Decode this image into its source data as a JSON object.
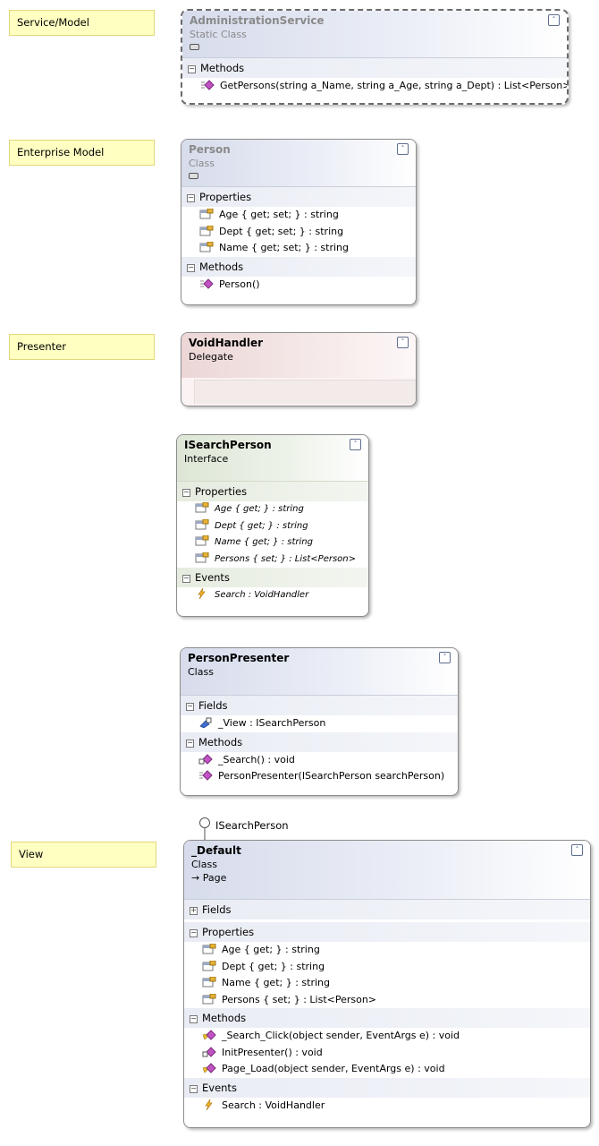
{
  "notes": {
    "service": "Service/Model",
    "enterprise": "Enterprise Model",
    "presenter": "Presenter",
    "view": "View"
  },
  "admin": {
    "name": "AdministrationService",
    "kind": "Static Class",
    "sections": [
      {
        "label": "Methods",
        "items": [
          "GetPersons(string a_Name, string a_Age, string a_Dept) : List<Person>"
        ]
      }
    ]
  },
  "person": {
    "name": "Person",
    "kind": "Class",
    "sections": [
      {
        "label": "Properties",
        "items": [
          "Age { get; set; } : string",
          "Dept { get; set; } : string",
          "Name { get; set; } : string"
        ]
      },
      {
        "label": "Methods",
        "items": [
          "Person()"
        ]
      }
    ]
  },
  "voidhandler": {
    "name": "VoidHandler",
    "kind": "Delegate"
  },
  "isearch": {
    "name": "ISearchPerson",
    "kind": "Interface",
    "sections": [
      {
        "label": "Properties",
        "items": [
          "Age { get; } : string",
          "Dept { get; } : string",
          "Name { get; } : string",
          "Persons { set; } : List<Person>"
        ]
      },
      {
        "label": "Events",
        "items": [
          "Search : VoidHandler"
        ]
      }
    ]
  },
  "presenter": {
    "name": "PersonPresenter",
    "kind": "Class",
    "sections": [
      {
        "label": "Fields",
        "items": [
          "_View : ISearchPerson"
        ]
      },
      {
        "label": "Methods",
        "items": [
          "_Search() : void",
          "PersonPresenter(ISearchPerson searchPerson)"
        ]
      }
    ]
  },
  "default": {
    "name": "_Default",
    "kind": "Class",
    "base": "Page",
    "interface_label": "ISearchPerson",
    "sections": [
      {
        "label": "Fields",
        "items": []
      },
      {
        "label": "Properties",
        "items": [
          "Age { get; } : string",
          "Dept { get; } : string",
          "Name { get; } : string",
          "Persons { set; } : List<Person>"
        ]
      },
      {
        "label": "Methods",
        "items": [
          "_Search_Click(object sender, EventArgs e) : void",
          "InitPresenter() : void",
          "Page_Load(object sender, EventArgs e) : void"
        ]
      },
      {
        "label": "Events",
        "items": [
          "Search : VoidHandler"
        ]
      }
    ]
  },
  "symbols": {
    "collapse": "˄",
    "minus": "−",
    "plus": "+",
    "inherits_arrow": "→"
  }
}
